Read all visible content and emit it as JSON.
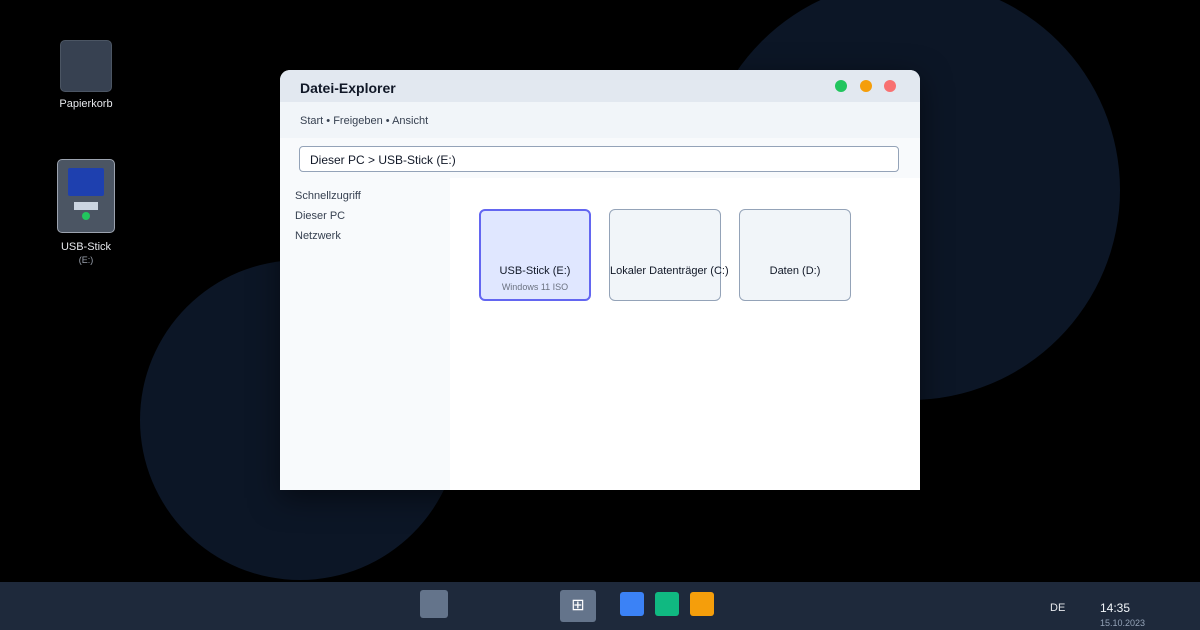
{
  "desktop": {
    "icons": [
      {
        "label": "Papierkorb"
      },
      {
        "label": "USB-Stick",
        "sub": "(E:)"
      }
    ]
  },
  "window": {
    "title": "Datei-Explorer",
    "ribbon": "Start • Freigeben • Ansicht",
    "address": "Dieser PC > USB-Stick (E:)",
    "nav": [
      "Schnellzugriff",
      "Dieser PC",
      "Netzwerk"
    ],
    "drives": [
      {
        "name": "USB-Stick (E:)",
        "sub": "Windows 11 ISO",
        "selected": true
      },
      {
        "name": "Lokaler Datenträger (C:)",
        "sub": "",
        "selected": false
      },
      {
        "name": "Daten (D:)",
        "sub": "",
        "selected": false
      }
    ]
  },
  "taskbar": {
    "start_glyph": "⊞",
    "language": "DE",
    "time": "14:35",
    "date": "15.10.2023"
  },
  "colors": {
    "window_close": "#f87171",
    "window_minimize": "#f59e0b",
    "window_maximize": "#22c55e",
    "selection_accent": "#6366f1",
    "taskbar": "#1e293b"
  },
  "icons": [
    "trash-icon",
    "usb-drive-icon",
    "search-icon",
    "windows-start-icon",
    "browser-app-icon",
    "green-app-icon",
    "orange-app-icon"
  ]
}
